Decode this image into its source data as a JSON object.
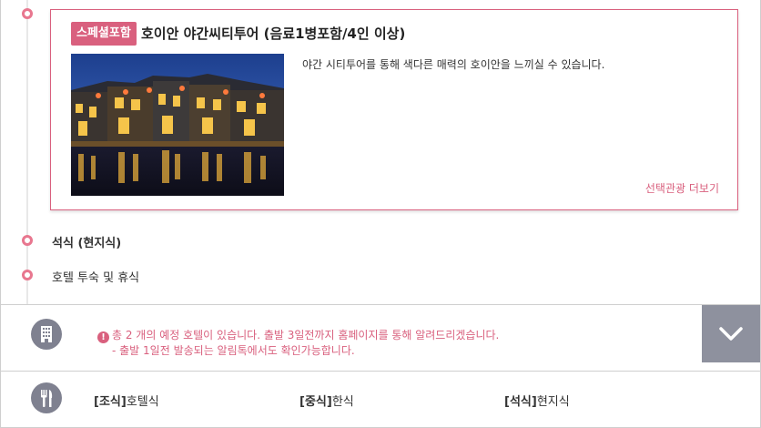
{
  "tour_card": {
    "badge": "스페셜포함",
    "title": "호이안 야간씨티투어 (음료1병포함/4인 이상)",
    "description": "야간 시티투어를 통해 색다른 매력의 호이안을 느끼실 수 있습니다.",
    "more_link": "선택관광 더보기",
    "photo_icon": "hoi-an-night-photo"
  },
  "timeline": {
    "items": [
      {
        "label": "석식 (현지식)"
      },
      {
        "label": "호텔 투숙 및 휴식"
      }
    ]
  },
  "hotel": {
    "icon": "building-icon",
    "notice_line1": "총 2 개의 예정 호텔이 있습니다. 출발 3일전까지 홈페이지를 통해 알려드리겠습니다.",
    "notice_line2": "- 출발 1일전 발송되는 알림톡에서도 확인가능합니다.",
    "warn_glyph": "!",
    "expand_icon": "chevron-down-icon"
  },
  "meals": {
    "icon": "utensils-icon",
    "items": [
      {
        "tag": "[조식]",
        "value": "호텔식"
      },
      {
        "tag": "[중식]",
        "value": "한식"
      },
      {
        "tag": "[석식]",
        "value": "현지식"
      }
    ]
  },
  "colors": {
    "accent": "#d9607e",
    "icon_gray": "#7f8190",
    "button_gray": "#8e919e"
  }
}
